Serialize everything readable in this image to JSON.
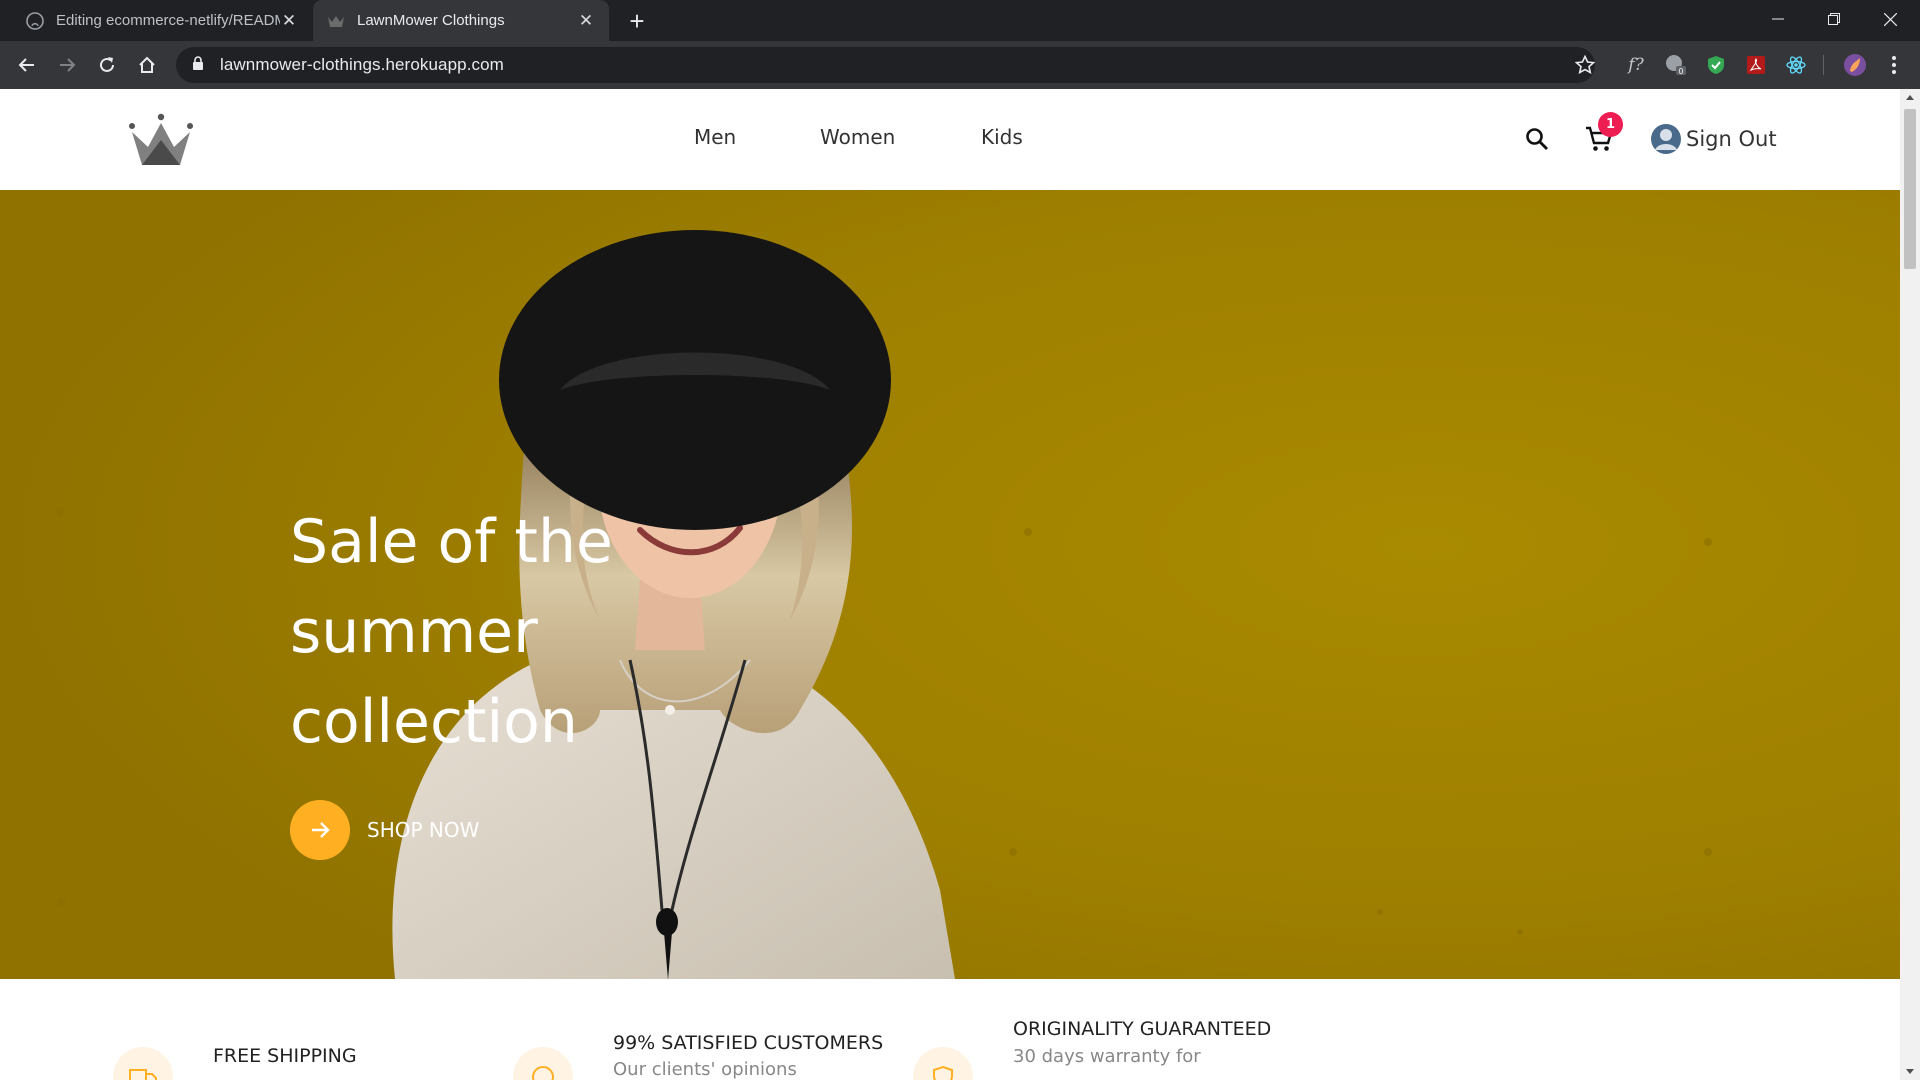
{
  "browser": {
    "tabs": [
      {
        "title": "Editing ecommerce-netlify/READM",
        "active": false
      },
      {
        "title": "LawnMower Clothings",
        "active": true
      }
    ],
    "url": "lawnmower-clothings.herokuapp.com"
  },
  "site": {
    "nav": [
      "Men",
      "Women",
      "Kids"
    ],
    "cart_count": "1",
    "signout_label": "Sign Out"
  },
  "hero": {
    "title_lines": [
      "Sale of the",
      "summer",
      "collection"
    ],
    "cta_label": "SHOP NOW"
  },
  "features": [
    {
      "title": "FREE SHIPPING",
      "desc": ""
    },
    {
      "title": "99% SATISFIED CUSTOMERS",
      "desc": "Our clients' opinions"
    },
    {
      "title": "ORIGINALITY GUARANTEED",
      "desc": "30 days warranty for"
    }
  ],
  "colors": {
    "hero_bg": "#b08e00",
    "accent": "#ffb022",
    "badge": "#ee1d52"
  }
}
